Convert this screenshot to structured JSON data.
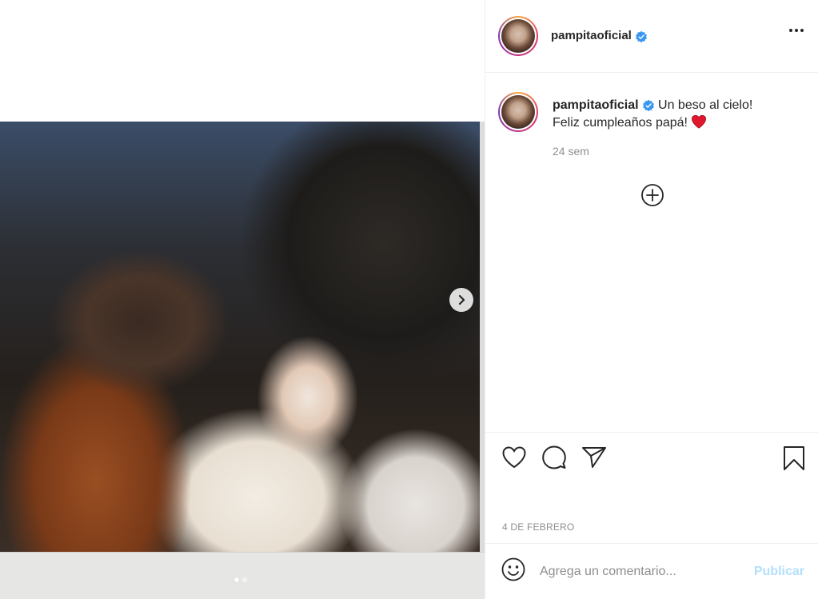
{
  "post": {
    "username": "pampitaoficial",
    "caption_line1": "Un beso al cielo!",
    "caption_line2": "Feliz cumpleaños papá!",
    "time_ago": "24 sem",
    "date": "4 DE FEBRERO"
  },
  "carousel": {
    "total_slides": 2,
    "active_slide": 1
  },
  "comment_box": {
    "placeholder": "Agrega un comentario...",
    "publish_label": "Publicar"
  },
  "colors": {
    "verified": "#3897f0",
    "heart_emoji": "#e0182d",
    "publish_disabled": "#b2dffc",
    "secondary_text": "#8e8e8e"
  },
  "icons": [
    "verified-badge-icon",
    "more-options-icon",
    "heart-emoji-icon",
    "load-more-comments-icon",
    "like-icon",
    "comment-icon",
    "share-icon",
    "save-icon",
    "emoji-icon",
    "carousel-next-icon"
  ]
}
